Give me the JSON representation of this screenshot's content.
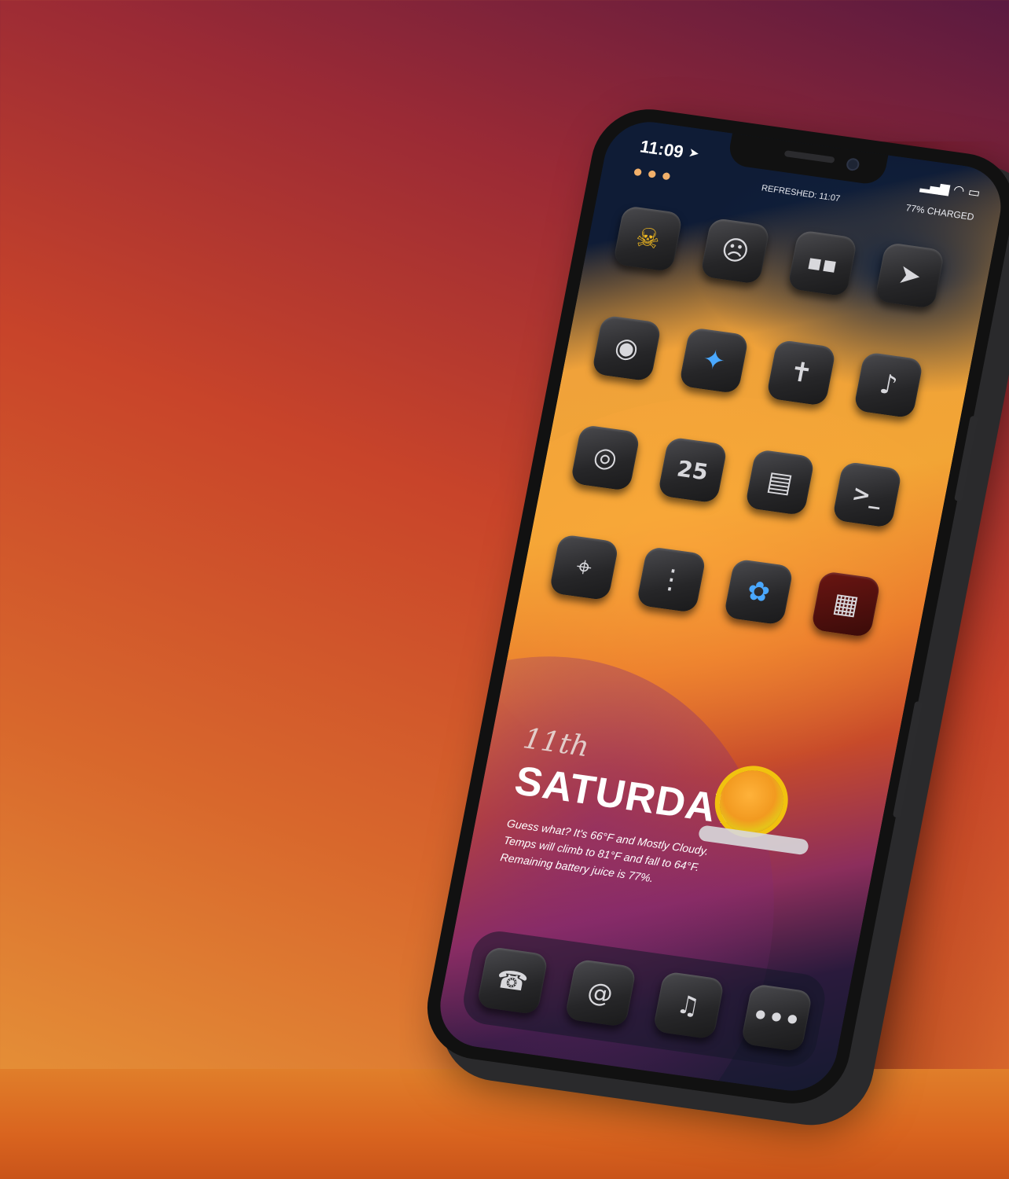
{
  "status_bar": {
    "time": "11:09",
    "location_icon": "location-arrow-icon",
    "system_icons": "signal-icon wifi-icon battery-icon",
    "refreshed": "REFRESHED: 11:07",
    "battery": "77% CHARGED"
  },
  "home": {
    "apps": [
      {
        "name": "app-weather-bird",
        "glyph": "☠",
        "icon": "bird-face-icon"
      },
      {
        "name": "app-ghostface",
        "glyph": "☹",
        "icon": "ghost-mask-icon"
      },
      {
        "name": "app-face",
        "glyph": "▪▪",
        "icon": "face-icon"
      },
      {
        "name": "app-paper-plane",
        "glyph": "➤",
        "icon": "paper-plane-icon"
      },
      {
        "name": "app-lock",
        "glyph": "◉",
        "icon": "lock-icon"
      },
      {
        "name": "app-compass",
        "glyph": "✦",
        "icon": "compass-icon"
      },
      {
        "name": "app-bible",
        "glyph": "✝",
        "icon": "cross-icon"
      },
      {
        "name": "app-tiktok",
        "glyph": "♪",
        "icon": "tiktok-icon"
      },
      {
        "name": "app-camera",
        "glyph": "◎",
        "icon": "triple-camera-icon"
      },
      {
        "name": "app-calendar",
        "glyph": "25",
        "icon": "calendar-icon"
      },
      {
        "name": "app-apple-tv",
        "glyph": "▤",
        "icon": "radio-icon"
      },
      {
        "name": "app-terminal",
        "glyph": ">_",
        "icon": "terminal-icon"
      },
      {
        "name": "app-maps",
        "glyph": "⌖",
        "icon": "map-pin-icon"
      },
      {
        "name": "app-shortcuts",
        "glyph": "⋮",
        "icon": "connector-icon"
      },
      {
        "name": "app-flower",
        "glyph": "✿",
        "icon": "flower-icon"
      },
      {
        "name": "app-folder",
        "glyph": "▦",
        "icon": "folder-grid-icon"
      }
    ],
    "date_widget": {
      "day_number": "11th",
      "weekday": "SATURDAY",
      "weather_line1": "Guess what? It's 66°F and Mostly Cloudy.",
      "weather_line2": "Temps will climb to 81°F and fall to 64°F.",
      "weather_line3": "Remaining battery juice is 77%."
    }
  },
  "dock": {
    "apps": [
      {
        "name": "dock-phone",
        "glyph": "☎",
        "icon": "rotary-phone-icon"
      },
      {
        "name": "dock-mail",
        "glyph": "@",
        "icon": "envelope-icon"
      },
      {
        "name": "dock-music",
        "glyph": "♫",
        "icon": "microphone-icon"
      },
      {
        "name": "dock-messages",
        "glyph": "•••",
        "icon": "message-dots-icon"
      }
    ]
  }
}
